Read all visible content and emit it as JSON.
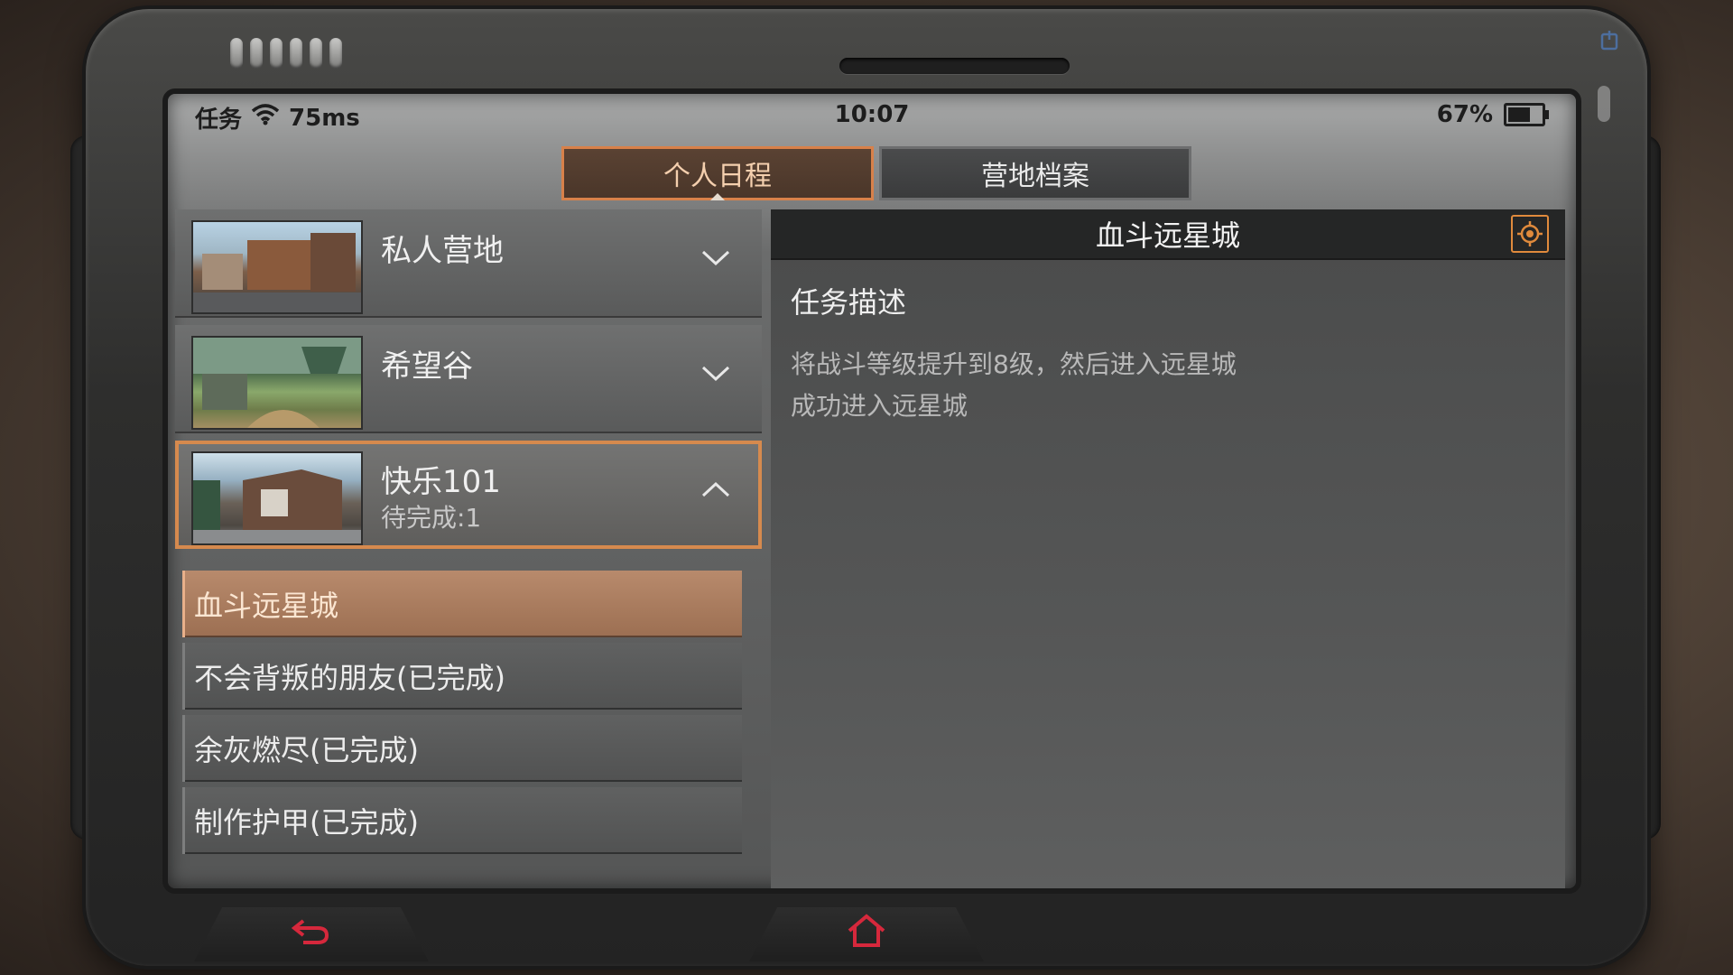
{
  "status_bar": {
    "app_label": "任务",
    "ping": "75ms",
    "time": "10:07",
    "battery_percent": "67%",
    "battery_level": 0.67
  },
  "tabs": [
    {
      "label": "个人日程",
      "active": true
    },
    {
      "label": "营地档案",
      "active": false
    }
  ],
  "maps": [
    {
      "name": "私人营地",
      "sub": "",
      "expanded": false
    },
    {
      "name": "希望谷",
      "sub": "",
      "expanded": false
    },
    {
      "name": "快乐101",
      "sub": "待完成:1",
      "expanded": true
    }
  ],
  "quests": [
    {
      "label": "血斗远星城",
      "active": true
    },
    {
      "label": "不会背叛的朋友(已完成)",
      "active": false
    },
    {
      "label": "余灰燃尽(已完成)",
      "active": false
    },
    {
      "label": "制作护甲(已完成)",
      "active": false
    }
  ],
  "detail": {
    "title": "血斗远星城",
    "section_title": "任务描述",
    "description_lines": [
      "将战斗等级提升到8级，然后进入远星城",
      "成功进入远星城"
    ]
  },
  "colors": {
    "accent": "#d8814a",
    "nav_red": "#d6283c"
  },
  "icons": {
    "back": "back-arrow-icon",
    "home": "home-icon",
    "locate": "crosshair-icon",
    "wifi": "wifi-icon",
    "battery": "battery-icon",
    "expand": "chevron-down-icon",
    "collapse": "chevron-up-icon"
  }
}
